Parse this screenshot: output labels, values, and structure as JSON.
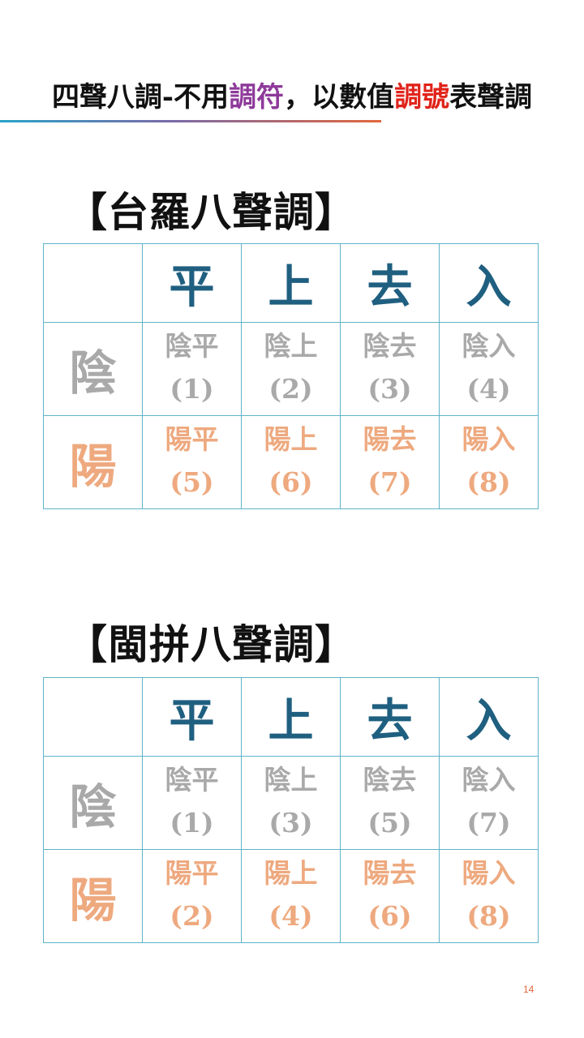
{
  "header": {
    "title_parts": [
      "四聲八調-不用",
      "調符",
      "，以數值",
      "調號",
      "表聲調"
    ],
    "accent_colors": {
      "purple": "#8e3a9a",
      "red": "#e0231a"
    }
  },
  "tables": [
    {
      "title": "【台羅八聲調】",
      "columns": [
        "平",
        "上",
        "去",
        "入"
      ],
      "rows": [
        {
          "label": "陰",
          "cells": [
            {
              "name": "陰平",
              "num": "(1)"
            },
            {
              "name": "陰上",
              "num": "(2)"
            },
            {
              "name": "陰去",
              "num": "(3)"
            },
            {
              "name": "陰入",
              "num": "(4)"
            }
          ]
        },
        {
          "label": "陽",
          "cells": [
            {
              "name": "陽平",
              "num": "(5)"
            },
            {
              "name": "陽上",
              "num": "(6)"
            },
            {
              "name": "陽去",
              "num": "(7)"
            },
            {
              "name": "陽入",
              "num": "(8)"
            }
          ]
        }
      ]
    },
    {
      "title": "【閩拼八聲調】",
      "columns": [
        "平",
        "上",
        "去",
        "入"
      ],
      "rows": [
        {
          "label": "陰",
          "cells": [
            {
              "name": "陰平",
              "num": "(1)"
            },
            {
              "name": "陰上",
              "num": "(3)"
            },
            {
              "name": "陰去",
              "num": "(5)"
            },
            {
              "name": "陰入",
              "num": "(7)"
            }
          ]
        },
        {
          "label": "陽",
          "cells": [
            {
              "name": "陽平",
              "num": "(2)"
            },
            {
              "name": "陽上",
              "num": "(4)"
            },
            {
              "name": "陽去",
              "num": "(6)"
            },
            {
              "name": "陽入",
              "num": "(8)"
            }
          ]
        }
      ]
    }
  ],
  "colors": {
    "column_header": "#1f5f80",
    "yin": "#a9a9a9",
    "yang": "#eea97f",
    "border": "#5fb3c9"
  },
  "page_number": "14"
}
